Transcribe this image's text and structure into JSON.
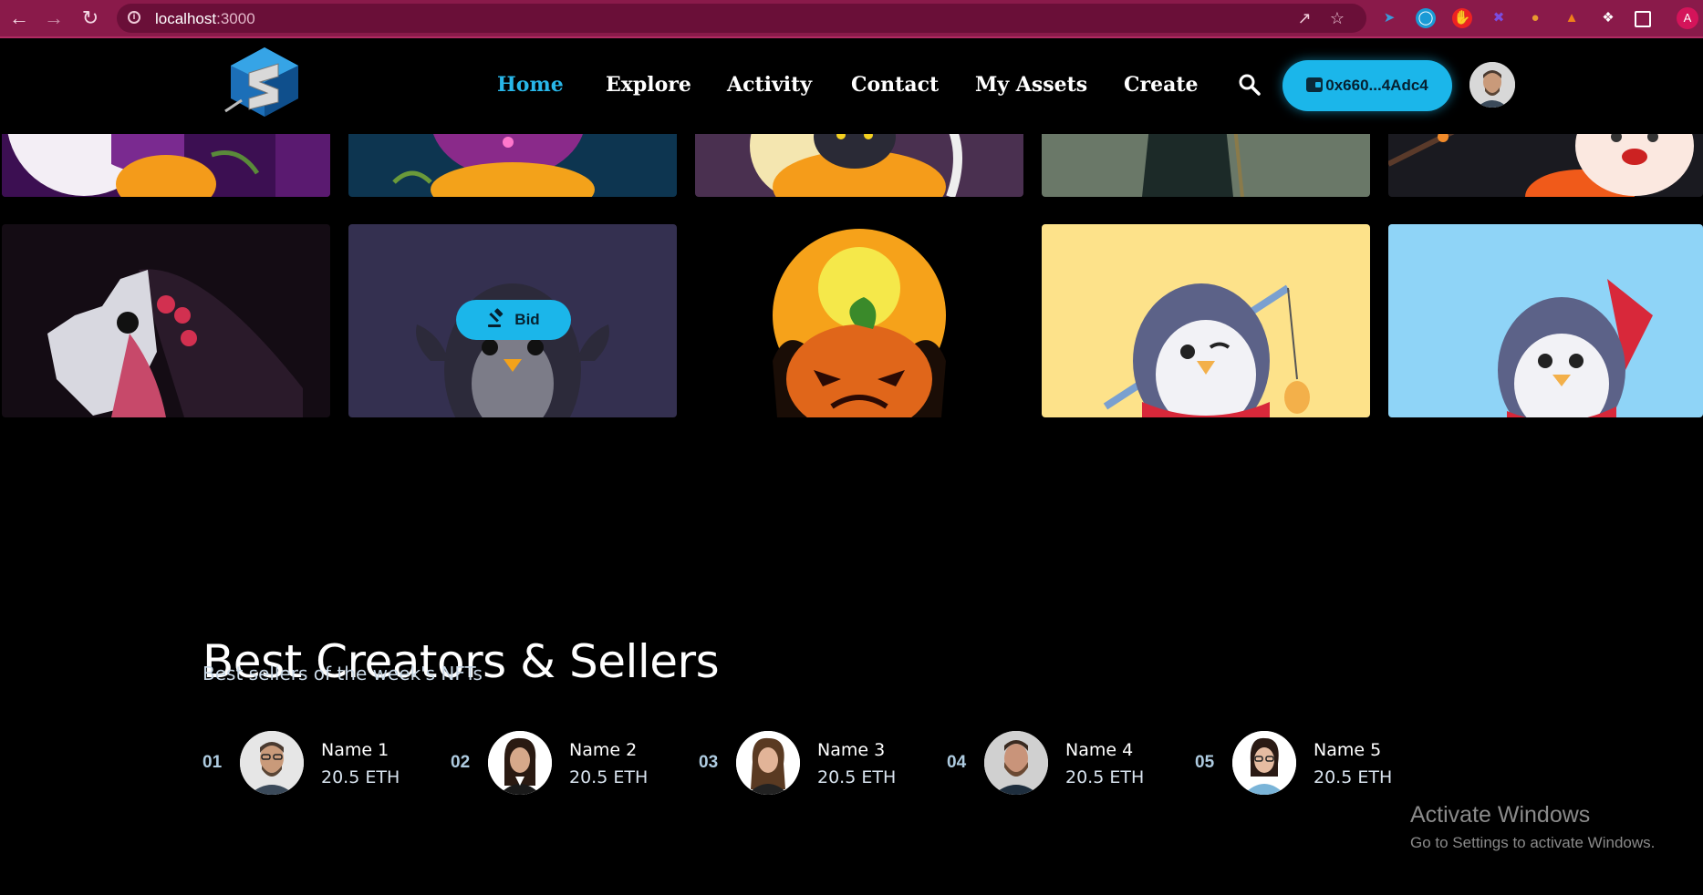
{
  "browser": {
    "url_host": "localhost",
    "url_port": ":3000"
  },
  "nav": {
    "items": [
      "Home",
      "Explore",
      "Activity",
      "Contact",
      "My Assets",
      "Create"
    ],
    "active": "Home"
  },
  "wallet": {
    "address": "0x660...4Adc4"
  },
  "gallery": {
    "bid_label": "Bid"
  },
  "creators_section": {
    "title": "Best Creators & Sellers",
    "subtitle": "Best sellers of the week's NFTs",
    "creators": [
      {
        "rank": "01",
        "name": "Name 1",
        "amount": "20.5 ETH"
      },
      {
        "rank": "02",
        "name": "Name 2",
        "amount": "20.5 ETH"
      },
      {
        "rank": "03",
        "name": "Name 3",
        "amount": "20.5 ETH"
      },
      {
        "rank": "04",
        "name": "Name 4",
        "amount": "20.5 ETH"
      },
      {
        "rank": "05",
        "name": "Name 5",
        "amount": "20.5 ETH"
      }
    ]
  },
  "os_watermark": {
    "title": "Activate Windows",
    "subtitle": "Go to Settings to activate Windows."
  },
  "colors": {
    "chrome_bar": "#8a1a4a",
    "accent": "#1bb6ea",
    "active_nav": "#28b6e8",
    "background": "#000000"
  }
}
